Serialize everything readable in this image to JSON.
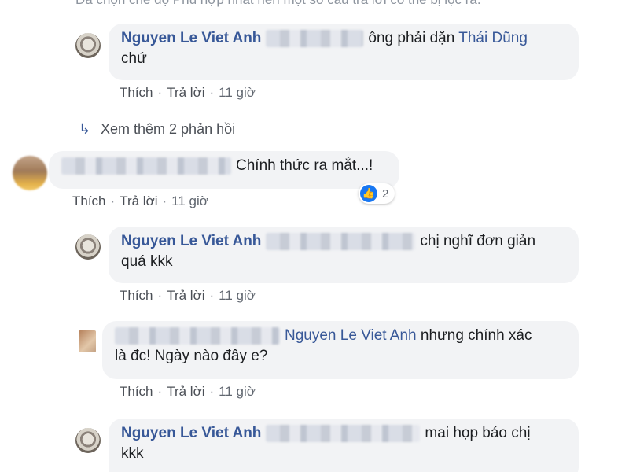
{
  "notice": "Đã chọn chế độ Phù hợp nhất nên một số câu trả lời có thể bị lọc ra.",
  "actions": {
    "like": "Thích",
    "reply": "Trả lời",
    "sep": "·"
  },
  "comments": [
    {
      "author": "Nguyen Le Viet Anh",
      "text_line1": "ông phải dặn",
      "mention": "Thái Dũng",
      "text_line2": "chứ",
      "time": "11 giờ"
    },
    {
      "text": "Chính thức ra mắt...!",
      "time": "11 giờ",
      "reaction_count": "2"
    },
    {
      "author": "Nguyen Le Viet Anh",
      "text_line1": "chị nghĩ đơn giản",
      "text_line2": "quá kkk",
      "time": "11 giờ"
    },
    {
      "mention": "Nguyen Le Viet Anh",
      "text_line1": "nhưng chính xác",
      "text_line2": "là đc! Ngày nào đây e?",
      "time": "11 giờ"
    },
    {
      "author": "Nguyen Le Viet Anh",
      "text_line1": "mai họp báo chị",
      "text_line2": "kkk"
    }
  ],
  "more_replies": "Xem thêm 2 phản hồi",
  "icons": {
    "more_replies": "reply-arrow-icon",
    "reaction": "like-icon"
  }
}
